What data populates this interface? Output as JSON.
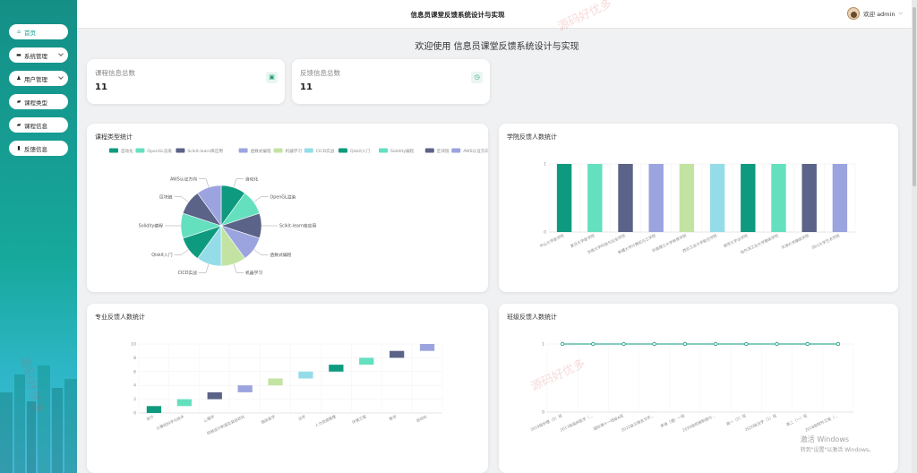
{
  "sidebar": {
    "items": [
      {
        "label": "首页",
        "icon": "home-icon",
        "active": true,
        "has_submenu": false
      },
      {
        "label": "系统管理",
        "icon": "monitor-icon",
        "active": false,
        "has_submenu": true
      },
      {
        "label": "用户管理",
        "icon": "user-icon",
        "active": false,
        "has_submenu": true
      },
      {
        "label": "课程类型",
        "icon": "folder-icon",
        "active": false,
        "has_submenu": false
      },
      {
        "label": "课程信息",
        "icon": "folder-icon",
        "active": false,
        "has_submenu": false
      },
      {
        "label": "反馈信息",
        "icon": "doc-icon",
        "active": false,
        "has_submenu": false
      }
    ]
  },
  "header": {
    "title": "信息员课堂反馈系统设计与实现",
    "user_label": "欢迎 admin"
  },
  "welcome": "欢迎使用 信息员课堂反馈系统设计与实现",
  "stats": [
    {
      "label": "课程信息总数",
      "value": "11",
      "icon": "calendar-icon"
    },
    {
      "label": "反馈信息总数",
      "value": "11",
      "icon": "clock-icon"
    }
  ],
  "panels": {
    "course_type": "课程类型统计",
    "college": "学院反馈人数统计",
    "major": "专业反馈人数统计",
    "class": "班级反馈人数统计"
  },
  "colors": [
    "#0e9a7e",
    "#64e0bf",
    "#5b6388",
    "#9ba4de",
    "#c3e3a3",
    "#94dde8",
    "#0e9a7e",
    "#64e0bf",
    "#5b6388",
    "#9ba4de"
  ],
  "watermark": "源码好优多",
  "windows_activation": {
    "line1": "激活 Windows",
    "line2": "转到\"设置\"以激活 Windows。"
  },
  "chart_data": [
    {
      "type": "pie",
      "title": "课程类型统计",
      "categories": [
        "自动化",
        "OpenGL渲染",
        "Scikit-learn库应用",
        "函数式编程",
        "机器学习",
        "CICD实战",
        "Qiskit入门",
        "Solidity编程",
        "区块链",
        "AWS认证方向"
      ],
      "values": [
        1,
        1,
        1,
        1,
        1,
        1,
        1,
        1,
        1,
        1
      ],
      "legend": "top"
    },
    {
      "type": "bar",
      "title": "学院反馈人数统计",
      "categories": [
        "中山大学医学院",
        "复旦大学医学院",
        "华南大学科技与社会学院",
        "新疆大学计算机与工学院",
        "华南理工大学体育学院",
        "西北工业大学航空学院",
        "南京大学法学院",
        "哈尔滨工业大学建筑学院",
        "天津大学建筑学院",
        "四川大学艺术学院"
      ],
      "values": [
        1,
        1,
        1,
        1,
        1,
        1,
        1,
        1,
        1,
        1
      ],
      "ylim": [
        0,
        1
      ]
    },
    {
      "type": "bar",
      "title": "专业反馈人数统计",
      "categories": [
        "会计",
        "计算机科学与技术",
        "心理学",
        "机械设计制造及其自动化",
        "临床医学",
        "法学",
        "人力资源管理",
        "环境工程",
        "数学",
        "自动化"
      ],
      "values": [
        [
          0,
          1
        ],
        [
          1,
          2
        ],
        [
          2,
          3
        ],
        [
          3,
          4
        ],
        [
          4,
          5
        ],
        [
          5,
          6
        ],
        [
          6,
          7
        ],
        [
          7,
          8
        ],
        [
          8,
          9
        ],
        [
          9,
          10
        ]
      ],
      "ylim": [
        0,
        10
      ]
    },
    {
      "type": "line",
      "title": "班级反馈人数统计",
      "categories": [
        "2019级护理（5）班",
        "2017级临床医学（...",
        "国际课十一班级A班",
        "2021级汉语言文学...",
        "英语（理）一班",
        "2020级机械制造与...",
        "高一（2）班",
        "2020级法学（1）班",
        "高二（一）班",
        "2018级软件工程（..."
      ],
      "values": [
        1,
        1,
        1,
        1,
        1,
        1,
        1,
        1,
        1,
        1
      ],
      "ylim": [
        0,
        1
      ]
    }
  ]
}
